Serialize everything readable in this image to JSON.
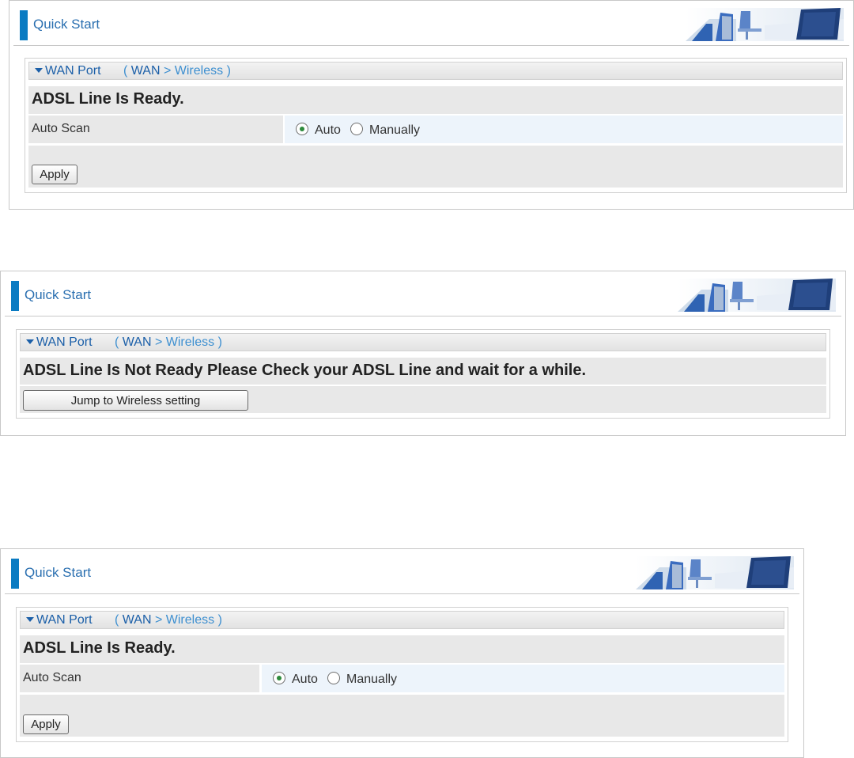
{
  "panels": [
    {
      "header_title": "Quick Start",
      "section": {
        "label": "WAN Port",
        "crumb_open": "(",
        "crumb_wan": "WAN",
        "crumb_sep": ">",
        "crumb_wireless": "Wireless",
        "crumb_close": ")"
      },
      "status": "ADSL Line Is Ready.",
      "auto_scan": {
        "label": "Auto Scan",
        "options": [
          "Auto",
          "Manually"
        ],
        "selected": "Auto"
      },
      "apply_label": "Apply"
    },
    {
      "header_title": "Quick Start",
      "section": {
        "label": "WAN Port",
        "crumb_open": "(",
        "crumb_wan": "WAN",
        "crumb_sep": ">",
        "crumb_wireless": "Wireless",
        "crumb_close": ")"
      },
      "status": "ADSL Line Is Not Ready Please Check your ADSL Line and wait for a while.",
      "jump_label": "Jump to Wireless setting"
    },
    {
      "header_title": "Quick Start",
      "section": {
        "label": "WAN Port",
        "crumb_open": "(",
        "crumb_wan": "WAN",
        "crumb_sep": ">",
        "crumb_wireless": "Wireless",
        "crumb_close": ")"
      },
      "status": "ADSL Line Is Ready.",
      "auto_scan": {
        "label": "Auto Scan",
        "options": [
          "Auto",
          "Manually"
        ],
        "selected": "Auto"
      },
      "apply_label": "Apply"
    }
  ],
  "colors": {
    "accent": "#0a7bc2",
    "title": "#2a6fb0",
    "section_label": "#1b5fa8",
    "crumb": "#3d8fd0",
    "row_gray": "#e8e8e8",
    "row_blue": "#edf4fb"
  },
  "icons": {
    "header_art": "office-chairs-desk-icon",
    "section_toggle": "caret-down-icon",
    "radio_selected": "radio-selected-icon",
    "radio_empty": "radio-empty-icon"
  }
}
